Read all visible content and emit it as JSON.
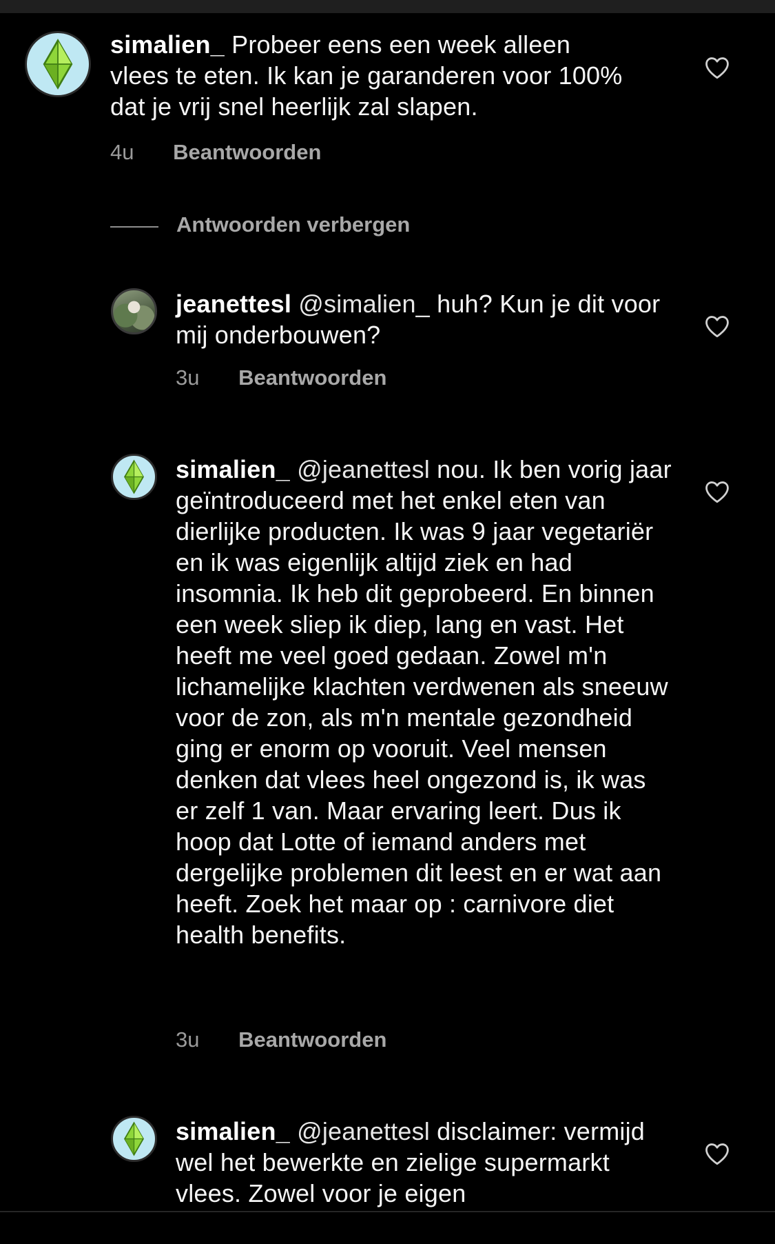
{
  "comments": [
    {
      "username": "simalien_",
      "mention": "",
      "text": "Probeer eens een week alleen vlees te eten. Ik kan je garanderen voor 100% dat je vrij snel heerlijk zal slapen.",
      "time": "4u",
      "reply_label": "Beantwoorden",
      "avatar_icon": "plumbob-icon"
    }
  ],
  "hide_replies_label": "Antwoorden verbergen",
  "replies": [
    {
      "username": "jeanettesl",
      "mention": "@simalien_",
      "text": "huh? Kun je dit voor mij onderbouwen?",
      "time": "3u",
      "reply_label": "Beantwoorden",
      "avatar_icon": "user-photo-avatar"
    },
    {
      "username": "simalien_",
      "mention": "@jeanettesl",
      "text": "nou. Ik ben vorig jaar geïntroduceerd met het enkel eten van dierlijke producten. Ik was 9 jaar vegetariër en ik was eigenlijk altijd ziek en had insomnia. Ik heb dit geprobeerd. En binnen een week sliep ik diep, lang en vast. Het heeft me veel goed gedaan. Zowel m'n lichamelijke klachten verdwenen als sneeuw voor de zon, als m'n mentale gezondheid ging er enorm op vooruit. Veel mensen denken dat vlees heel ongezond is, ik was er zelf 1 van. Maar ervaring leert. Dus ik hoop dat Lotte of iemand anders met dergelijke problemen dit leest en er wat aan heeft. Zoek het maar op : carnivore diet health benefits.",
      "time": "3u",
      "reply_label": "Beantwoorden",
      "avatar_icon": "plumbob-icon"
    },
    {
      "username": "simalien_",
      "mention": "@jeanettesl",
      "text": "disclaimer: vermijd wel het bewerkte en zielige supermarkt vlees. Zowel voor je eigen",
      "time": "",
      "reply_label": "",
      "avatar_icon": "plumbob-icon"
    }
  ],
  "colors": {
    "background": "#000000",
    "text": "#f5f5f5",
    "meta": "#9a9a9a",
    "plumbob_green": "#8fd63a",
    "avatar_bg": "#bfe8f3"
  }
}
